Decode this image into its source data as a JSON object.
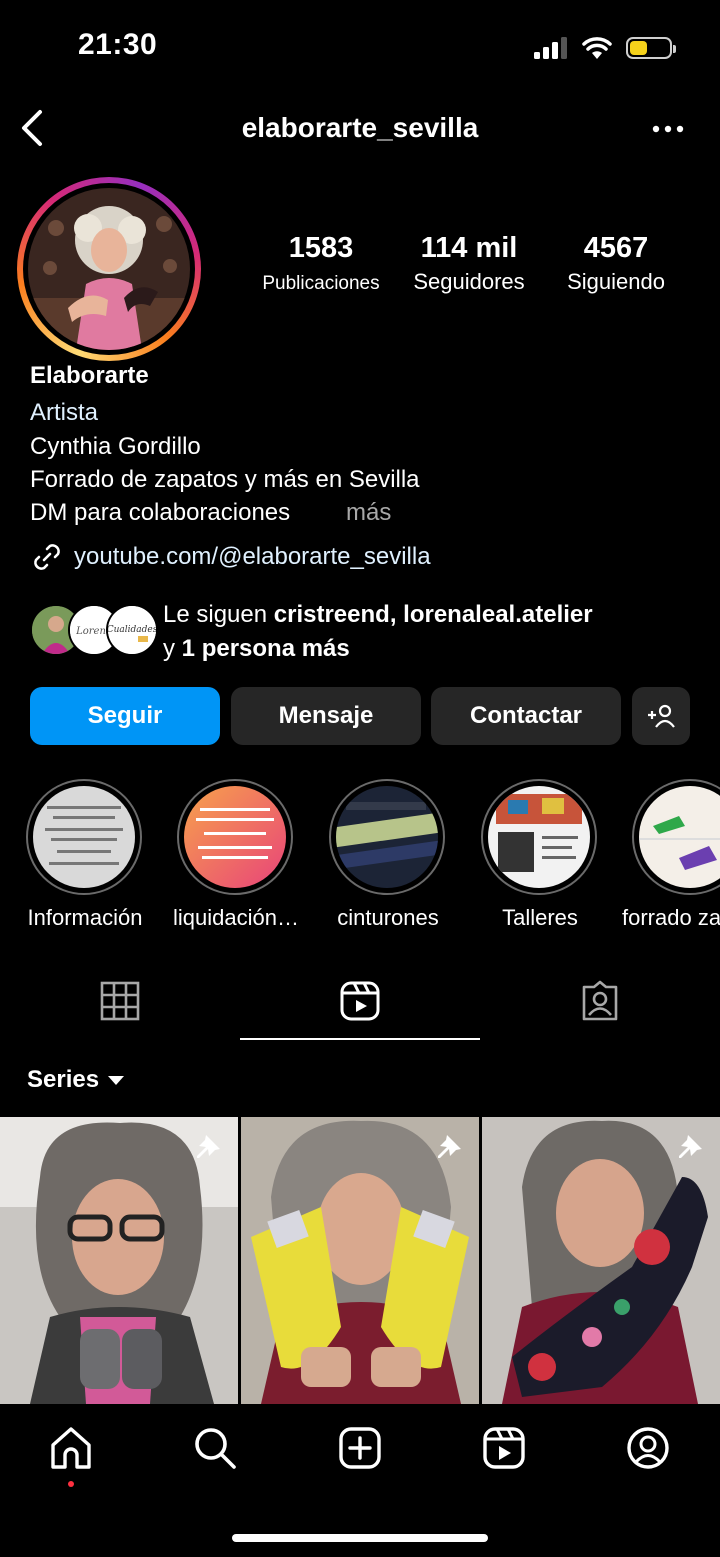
{
  "status_bar": {
    "time": "21:30"
  },
  "header": {
    "username": "elaborarte_sevilla"
  },
  "profile": {
    "stats": [
      {
        "value": "1583",
        "label": "Publicaciones"
      },
      {
        "value": "114 mil",
        "label": "Seguidores"
      },
      {
        "value": "4567",
        "label": "Siguiendo"
      }
    ],
    "display_name": "Elaborarte",
    "category": "Artista",
    "bio_lines": [
      "Cynthia Gordillo",
      "Forrado de zapatos y más en Sevilla",
      "DM para colaboraciones"
    ],
    "more_label": "más",
    "link": "youtube.com/@elaborarte_sevilla",
    "followed_by": {
      "prefix": "Le siguen ",
      "names": "cristreend, lorenaleal.atelier",
      "line2_prefix": "y ",
      "others": "1 persona más"
    }
  },
  "buttons": {
    "follow": "Seguir",
    "message": "Mensaje",
    "contact": "Contactar"
  },
  "highlights": [
    {
      "label": "Información"
    },
    {
      "label": "liquidación…"
    },
    {
      "label": "cinturones"
    },
    {
      "label": "Talleres"
    },
    {
      "label": "forrado za"
    }
  ],
  "feed": {
    "filter_label": "Series"
  },
  "colors": {
    "accent": "#0095f6",
    "button_bg": "#262626",
    "notification": "#ff3040"
  },
  "icons": {
    "tabs": [
      "grid-icon",
      "reels-icon",
      "tagged-icon"
    ],
    "nav": [
      "home-icon",
      "search-icon",
      "create-icon",
      "reels-icon",
      "profile-icon"
    ]
  }
}
